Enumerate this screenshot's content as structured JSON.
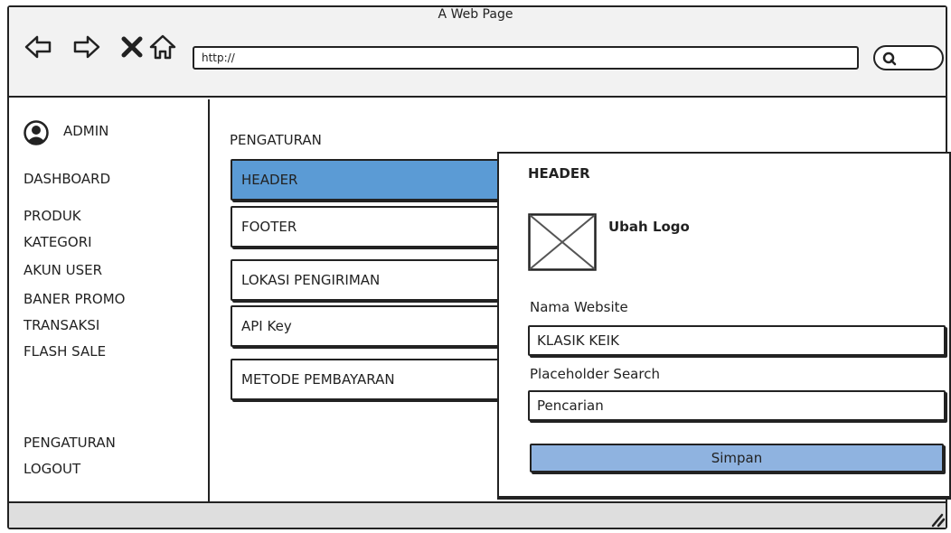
{
  "window": {
    "title": "A Web Page"
  },
  "browser": {
    "url": "http://",
    "icons": [
      "back-arrow-icon",
      "forward-arrow-icon",
      "close-x-icon",
      "home-icon",
      "search-icon"
    ]
  },
  "sidebar": {
    "user": {
      "label": "ADMIN",
      "icon": "user-avatar-icon"
    },
    "items": [
      {
        "label": "DASHBOARD"
      },
      {
        "label": "PRODUK"
      },
      {
        "label": "KATEGORI"
      },
      {
        "label": "AKUN USER"
      },
      {
        "label": "BANER PROMO"
      },
      {
        "label": "TRANSAKSI"
      },
      {
        "label": "FLASH SALE"
      }
    ],
    "bottom_items": [
      {
        "label": "PENGATURAN"
      },
      {
        "label": "LOGOUT"
      }
    ]
  },
  "settings": {
    "title": "PENGATURAN",
    "menu": [
      {
        "label": "HEADER",
        "active": true
      },
      {
        "label": "FOOTER"
      },
      {
        "label": "LOKASI PENGIRIMAN"
      },
      {
        "label": "API Key"
      },
      {
        "label": "METODE PEMBAYARAN"
      }
    ]
  },
  "panel": {
    "title": "HEADER",
    "logo_label": "Ubah Logo",
    "fields": [
      {
        "label": "Nama Website",
        "value": "KLASIK KEIK"
      },
      {
        "label": "Placeholder Search",
        "value": "Pencarian"
      }
    ],
    "save_label": "Simpan"
  },
  "colors": {
    "active_menu": "#5b9bd5",
    "save_button": "#8fb3e0"
  }
}
